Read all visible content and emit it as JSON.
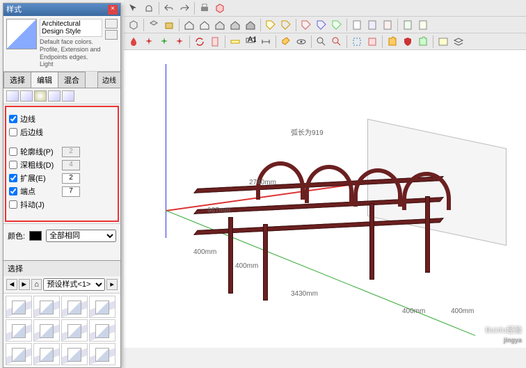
{
  "panel": {
    "title": "样式",
    "style_name": "Architectural Design Style",
    "style_desc": "Default face colors. Profile, Extension and Endpoints edges. Light",
    "tabs": {
      "select": "选择",
      "edit": "编辑",
      "mix": "混合",
      "right": "边线"
    },
    "edges": {
      "edge_label": "边线",
      "edge_checked": true,
      "back_label": "后边线",
      "back_checked": false,
      "profile_label": "轮廓线(P)",
      "profile_checked": false,
      "profile_val": "2",
      "depth_label": "深粗线(D)",
      "depth_checked": false,
      "depth_val": "4",
      "ext_label": "扩展(E)",
      "ext_checked": true,
      "ext_val": "2",
      "end_label": "端点",
      "end_checked": true,
      "end_val": "7",
      "jitter_label": "抖动(J)",
      "jitter_checked": false
    },
    "color": {
      "label": "颜色:",
      "mode": "全部相同"
    },
    "lower_title": "选择",
    "preset": "预设样式<1>"
  },
  "model": {
    "arc_label": "弧长为919",
    "d1": "2740mm",
    "d2": "967mm",
    "d3": "400mm",
    "d4": "400mm",
    "d5": "3430mm",
    "d6": "400mm",
    "d7": "400mm"
  },
  "watermark": {
    "brand": "Baidu经验",
    "sub": "jingya"
  }
}
